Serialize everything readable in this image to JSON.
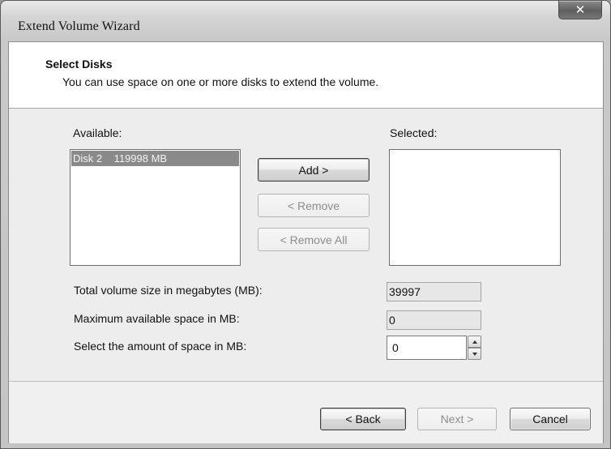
{
  "window": {
    "title": "Extend Volume Wizard",
    "close_glyph": "✕"
  },
  "header": {
    "title": "Select Disks",
    "subtitle": "You can use space on one or more disks to extend the volume."
  },
  "available": {
    "label": "Available:",
    "items": [
      {
        "text": "Disk 2    119998 MB",
        "selected": true
      }
    ]
  },
  "selected": {
    "label": "Selected:",
    "items": []
  },
  "actions": {
    "add_label": "Add >",
    "remove_label": "< Remove",
    "remove_all_label": "< Remove All"
  },
  "fields": {
    "total_size_label": "Total volume size in megabytes (MB):",
    "total_size_value": "39997",
    "max_space_label": "Maximum available space in MB:",
    "max_space_value": "0",
    "amount_label": "Select the amount of space in MB:",
    "amount_value": "0"
  },
  "footer": {
    "back_label": "< Back",
    "next_label": "Next >",
    "cancel_label": "Cancel"
  },
  "colors": {
    "selection_bg": "#8a8a8a",
    "header_bg": "#ffffff",
    "body_bg": "#ededed"
  },
  "icons": {
    "close": "close-icon",
    "spin_up": "chevron-up-icon",
    "spin_down": "chevron-down-icon"
  }
}
